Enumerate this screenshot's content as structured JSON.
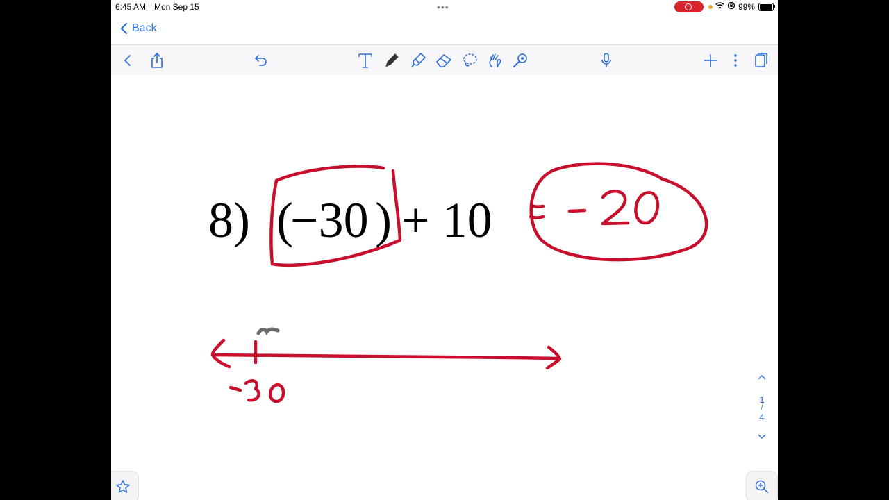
{
  "status_bar": {
    "time": "6:45 AM",
    "date": "Mon Sep 15",
    "battery": "99%"
  },
  "nav": {
    "back_label": "Back"
  },
  "toolbar": {
    "icons": [
      "chevron-left-icon",
      "share-icon",
      "undo-icon",
      "text-tool-icon",
      "pen-icon",
      "highlighter-icon",
      "eraser-icon",
      "lasso-icon",
      "hand-draw-icon",
      "laser-pointer-icon",
      "microphone-icon",
      "plus-icon",
      "more-icon",
      "pages-icon"
    ]
  },
  "page": {
    "problem_number": "8)",
    "problem_expr_open": "(",
    "problem_expr_value": "−30",
    "problem_expr_close": ")",
    "problem_expr_rest": "+ 10",
    "handwritten_answer": "= -20",
    "number_line_label": "-30"
  },
  "pager": {
    "current": "1",
    "total": "4"
  },
  "colors": {
    "ink_red": "#c8102e",
    "accent_blue": "#2f6fd6",
    "ink_gray": "#6b6b6b"
  }
}
